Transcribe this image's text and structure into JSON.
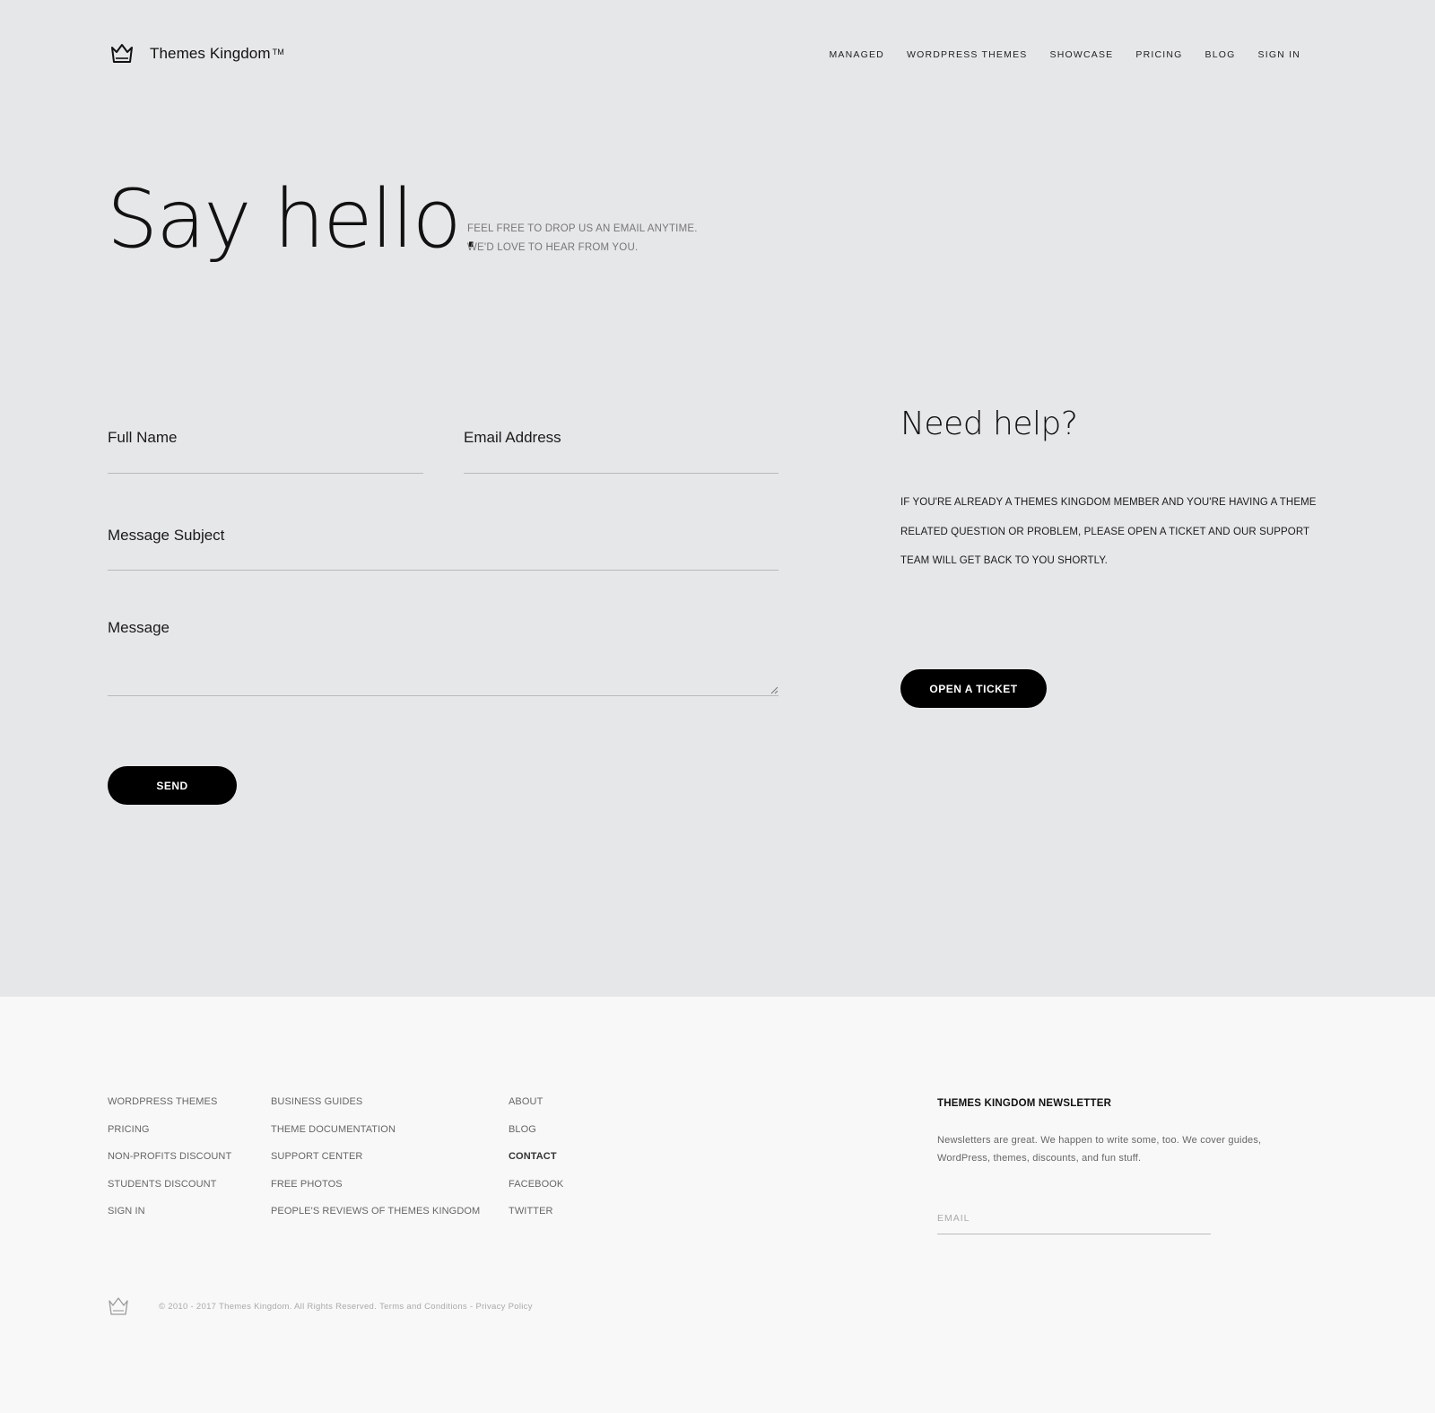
{
  "header": {
    "brand": "Themes Kingdom",
    "trademark": "TM",
    "nav": [
      "MANAGED",
      "WORDPRESS THEMES",
      "SHOWCASE",
      "PRICING",
      "BLOG",
      "SIGN IN"
    ]
  },
  "intro": {
    "title": "Say hello.",
    "line1": "FEEL FREE TO DROP US AN EMAIL ANYTIME.",
    "line2": "WE'D LOVE TO HEAR FROM YOU."
  },
  "form": {
    "full_name_label": "Full Name",
    "full_name_value": "",
    "email_label": "Email Address",
    "email_value": "",
    "subject_label": "Message Subject",
    "subject_value": "",
    "message_label": "Message",
    "message_value": "",
    "send_label": "SEND"
  },
  "help": {
    "title": "Need help?",
    "text": "IF YOU'RE ALREADY A THEMES KINGDOM MEMBER AND YOU'RE HAVING A THEME RELATED QUESTION OR PROBLEM, PLEASE OPEN A TICKET AND OUR SUPPORT TEAM WILL GET BACK TO YOU SHORTLY.",
    "button_label": "OPEN A TICKET"
  },
  "footer": {
    "col1": [
      "WORDPRESS THEMES",
      "PRICING",
      "NON-PROFITS DISCOUNT",
      "STUDENTS DISCOUNT",
      "SIGN IN"
    ],
    "col2": [
      "BUSINESS GUIDES",
      "THEME DOCUMENTATION",
      "SUPPORT CENTER",
      "FREE PHOTOS",
      "PEOPLE'S REVIEWS OF THEMES KINGDOM"
    ],
    "col3": [
      "ABOUT",
      "BLOG",
      "CONTACT",
      "FACEBOOK",
      "TWITTER"
    ],
    "active_item": "CONTACT",
    "newsletter_title": "THEMES KINGDOM NEWSLETTER",
    "newsletter_text": "Newsletters are great. We happen to write some, too. We cover guides, WordPress, themes, discounts, and fun stuff.",
    "newsletter_placeholder": "EMAIL",
    "copyright": "© 2010 - 2017 Themes Kingdom. All Rights Reserved.",
    "terms": "Terms and Conditions",
    "separator": "-",
    "privacy": "Privacy Policy"
  },
  "colors": {
    "hero_bg": "#e6e7e9",
    "footer_bg": "#f8f8f8",
    "button_bg": "#000000",
    "button_text": "#ffffff"
  }
}
